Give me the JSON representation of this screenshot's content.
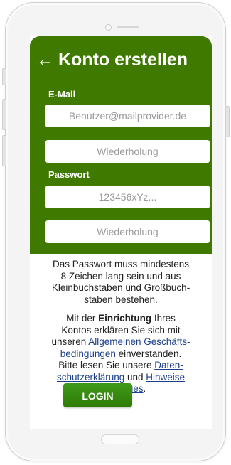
{
  "header": {
    "title": "Konto erstellen"
  },
  "form": {
    "email_label": "E-Mail",
    "email_placeholder": "Benutzer@mailprovider.de",
    "email_repeat_placeholder": "Wiederholung",
    "password_label": "Passwort",
    "password_placeholder": "123456xYz...",
    "password_repeat_placeholder": "Wiederholung"
  },
  "info": {
    "password_rules_lines": [
      "Das Passwort muss mindestens",
      "8 Zeichen lang sein und aus",
      "Kleinbuchstaben und Großbuch-",
      "staben bestehen."
    ],
    "consent_prefix": "Mit der ",
    "consent_bold": "Einrichtung",
    "consent_suffix": " Ihres",
    "consent_line2": "Kontos erklären Sie sich mit",
    "consent_line3_prefix": "unseren ",
    "terms_link_line1": "Allgemeinen Geschäfts-",
    "terms_link_line2": "bedingungen",
    "consent_line4_suffix": " einverstanden.",
    "read_prefix": "Bitte lesen Sie unsere ",
    "privacy_link_line1": "Daten-",
    "privacy_link_line2": "schutzerklärung",
    "and_word": " und ",
    "cookies_link_line1": "Hinweise",
    "cookies_link_line2": "zu Cookies",
    "period": "."
  },
  "actions": {
    "login_label": "LOGIN"
  },
  "colors": {
    "brand_green": "#3f7900",
    "button_green": "#339211",
    "link_blue": "#1b3f8a"
  }
}
